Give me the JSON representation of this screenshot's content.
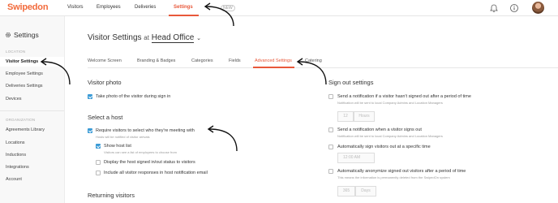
{
  "topnav": {
    "logo": "Swipedon",
    "items": [
      "Visitors",
      "Employees",
      "Deliveries",
      "Settings"
    ],
    "help_label": "NEW"
  },
  "sidebar": {
    "title": "Settings",
    "location_section": "LOCATION",
    "location_items": [
      "Visitor Settings",
      "Employee Settings",
      "Deliveries Settings",
      "Devices"
    ],
    "organization_section": "ORGANIZATION",
    "organization_items": [
      "Agreements Library",
      "Locations",
      "Inductions",
      "Integrations",
      "Account"
    ]
  },
  "page": {
    "title_prefix": "Visitor Settings",
    "title_at": "at",
    "location": "Head Office",
    "chevron": "⌄"
  },
  "tabs": [
    "Welcome Screen",
    "Branding & Badges",
    "Categories",
    "Fields",
    "Advanced Settings",
    "Catering"
  ],
  "left": {
    "visitor_photo": {
      "heading": "Visitor photo",
      "take_photo": "Take photo of the visitor during sign in"
    },
    "select_host": {
      "heading": "Select a host",
      "require": "Require visitors to select who they're meeting with",
      "require_sub": "Hosts will be notified of visitor arrivals",
      "show_list": "Show host list",
      "show_list_sub": "Visitors can see a list of employees to choose from",
      "display_status": "Display the host signed in/out status to visitors",
      "include_responses": "Include all visitor responses in host notification email"
    },
    "returning": {
      "heading": "Returning visitors"
    }
  },
  "right": {
    "heading": "Sign out settings",
    "notify_period": "Send a notification if a visitor hasn't signed out after a period of time",
    "notify_period_sub": "Notification will be sent to local Company Admins and Location Managers",
    "period_value": "12",
    "period_unit": "Hours",
    "notify_signout": "Send a notification when a visitor signs out",
    "notify_signout_sub": "Notification will be sent to local Company Admins and Location Managers",
    "auto_signout": "Automatically sign visitors out at a specific time",
    "auto_time": "12:00 AM",
    "auto_anonymize": "Automatically anonymize signed out visitors after a period of time",
    "auto_anonymize_sub": "This means the information is permanently deleted from the SwipedOn system",
    "anonymize_value": "365",
    "anonymize_unit": "Days"
  },
  "colors": {
    "accent": "#e8583a",
    "checkbox": "#3b9bd6"
  },
  "icons": {
    "bell": "bell-icon",
    "info": "info-icon",
    "gear": "gear-icon"
  }
}
